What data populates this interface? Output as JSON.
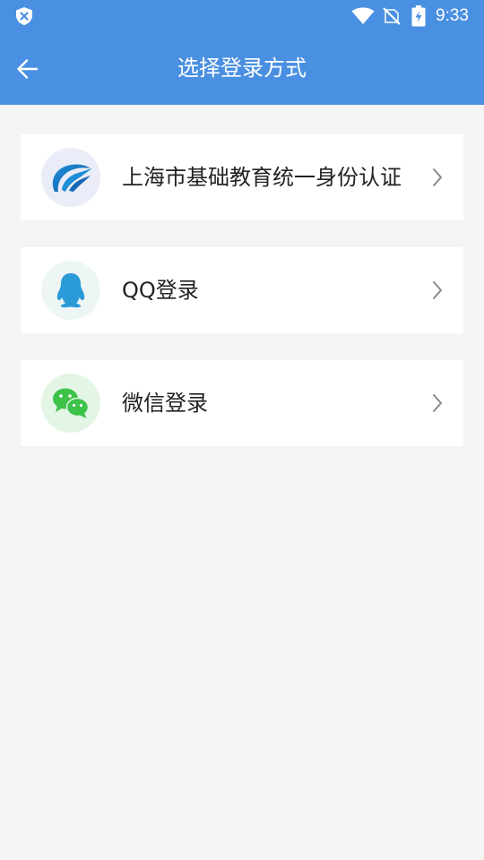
{
  "status_bar": {
    "time": "9:33",
    "icons": [
      "shield-x-icon",
      "wifi-icon",
      "no-sim-icon",
      "battery-charging-icon"
    ]
  },
  "toolbar": {
    "title": "选择登录方式",
    "back_icon": "arrow-left-icon"
  },
  "login_options": [
    {
      "label": "上海市基础教育统一身份认证",
      "icon": "edu-logo-icon"
    },
    {
      "label": "QQ登录",
      "icon": "qq-penguin-icon"
    },
    {
      "label": "微信登录",
      "icon": "wechat-icon"
    }
  ],
  "colors": {
    "app_bar": "#4a90e2",
    "background": "#f4f4f4",
    "card": "#ffffff",
    "qq_blue": "#2b9bd8",
    "wechat_green": "#3dc24a"
  }
}
